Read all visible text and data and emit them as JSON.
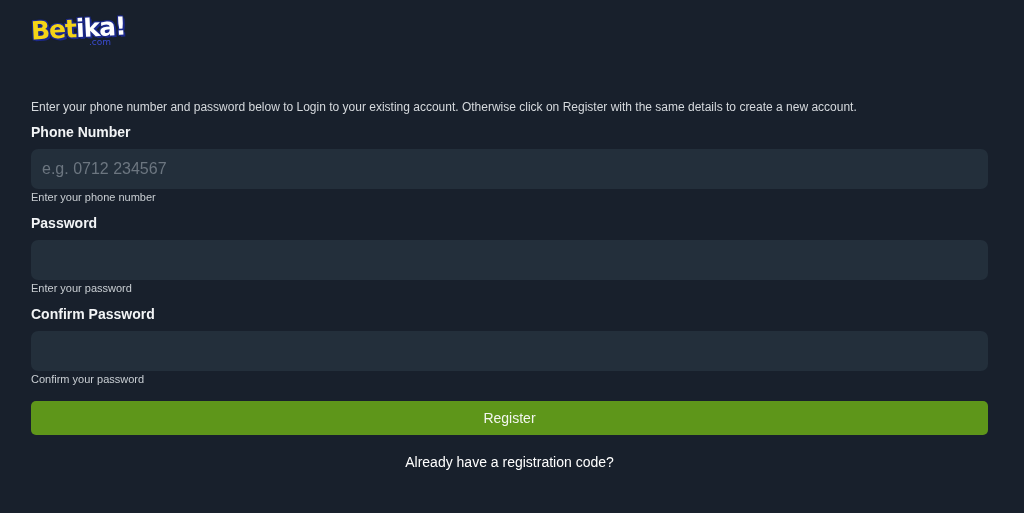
{
  "logo": {
    "primary": "Bet",
    "accent": "ika!",
    "domain": ".com"
  },
  "intro": "Enter your phone number and password below to Login to your existing account. Otherwise click on Register with the same details to create a new account.",
  "fields": [
    {
      "label": "Phone Number",
      "placeholder": "e.g. 0712 234567",
      "hint": "Enter your phone number"
    },
    {
      "label": "Password",
      "hint": "Enter your password"
    },
    {
      "label": "Confirm Password",
      "hint": "Confirm your password"
    }
  ],
  "submit": "Register",
  "link": "Already have a registration code?"
}
